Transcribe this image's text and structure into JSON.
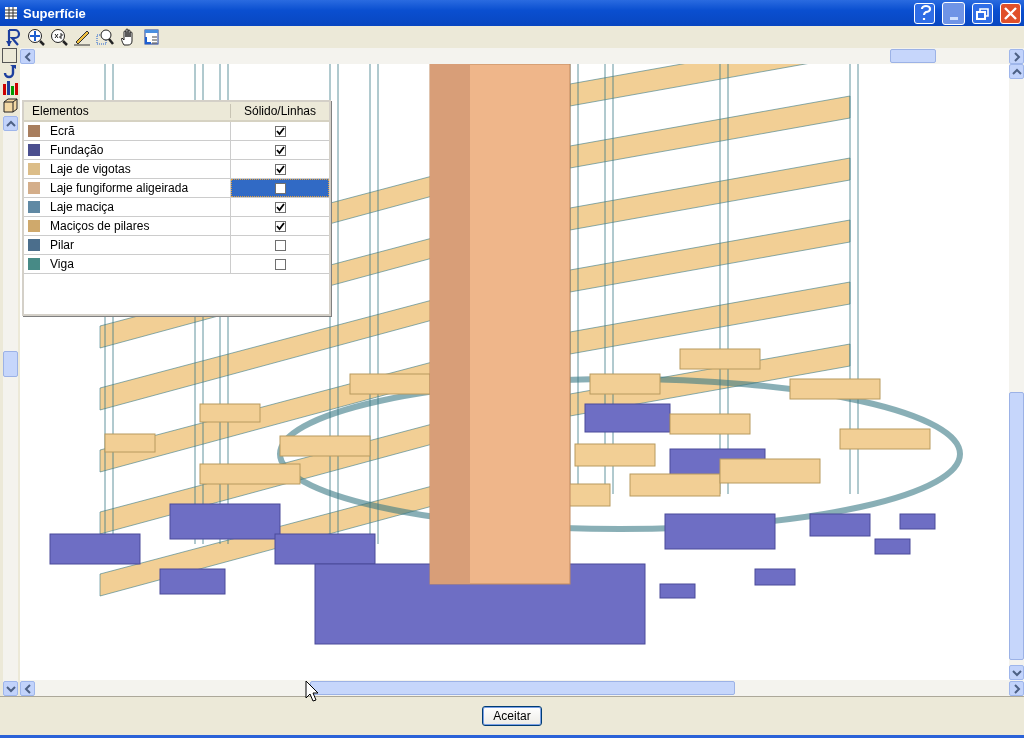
{
  "window": {
    "title": "Superfície"
  },
  "legend": {
    "columns": [
      "Elementos",
      "Sólido/Linhas"
    ],
    "rows": [
      {
        "name": "Ecrã",
        "color": "#a87e5e",
        "checked": true,
        "selected": false
      },
      {
        "name": "Fundação",
        "color": "#4b4f8f",
        "checked": true,
        "selected": false
      },
      {
        "name": "Laje de vigotas",
        "color": "#dcbd88",
        "checked": true,
        "selected": false
      },
      {
        "name": "Laje fungiforme aligeirada",
        "color": "#d4ae8a",
        "checked": false,
        "selected": true
      },
      {
        "name": "Laje maciça",
        "color": "#6089a4",
        "checked": true,
        "selected": false
      },
      {
        "name": "Maciços de pilares",
        "color": "#cfa96c",
        "checked": true,
        "selected": false
      },
      {
        "name": "Pilar",
        "color": "#4b6e8c",
        "checked": false,
        "selected": false
      },
      {
        "name": "Viga",
        "color": "#478a86",
        "checked": false,
        "selected": false
      }
    ]
  },
  "buttons": [
    "Aceitar"
  ]
}
